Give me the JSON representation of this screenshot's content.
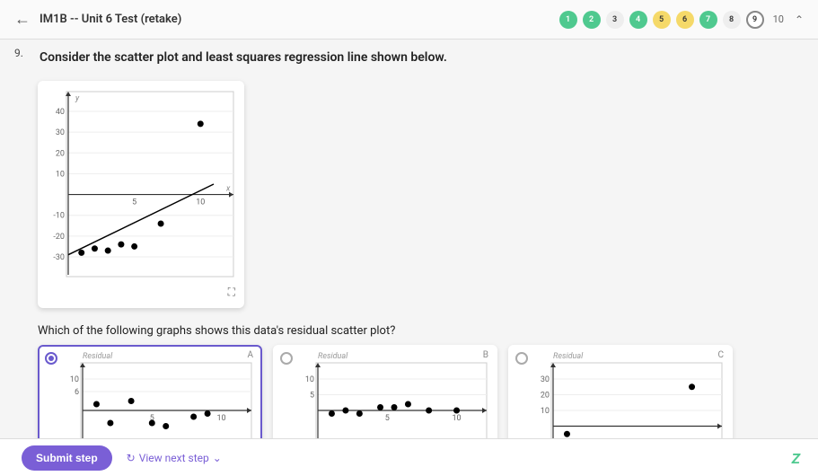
{
  "header": {
    "title": "IM1B -- Unit 6 Test (retake)",
    "nav": [
      {
        "label": "1",
        "cls": "green"
      },
      {
        "label": "2",
        "cls": "green"
      },
      {
        "label": "3",
        "cls": "plain"
      },
      {
        "label": "4",
        "cls": "green"
      },
      {
        "label": "5",
        "cls": "yellow"
      },
      {
        "label": "6",
        "cls": "yellow"
      },
      {
        "label": "7",
        "cls": "green"
      },
      {
        "label": "8",
        "cls": "plain"
      },
      {
        "label": "9",
        "cls": "current"
      }
    ],
    "total": "10"
  },
  "question": {
    "number": "9.",
    "prompt": "Consider the scatter plot and least squares regression line shown below.",
    "subprompt": "Which of the following graphs shows this data's residual scatter plot?"
  },
  "chart_data": {
    "type": "scatter",
    "title": "",
    "xlabel": "x",
    "ylabel": "y",
    "xlim": [
      0,
      11
    ],
    "ylim": [
      -30,
      40
    ],
    "xticks": [
      5,
      10
    ],
    "yticks": [
      -30,
      -20,
      -10,
      10,
      20,
      30,
      40
    ],
    "points": [
      {
        "x": 1,
        "y": -28
      },
      {
        "x": 2,
        "y": -26
      },
      {
        "x": 3,
        "y": -27
      },
      {
        "x": 4,
        "y": -24
      },
      {
        "x": 5,
        "y": -25
      },
      {
        "x": 7,
        "y": -14
      },
      {
        "x": 10,
        "y": 34
      }
    ],
    "regression_line": {
      "x1": 0,
      "y1": -29,
      "x2": 11,
      "y2": 5
    }
  },
  "options": [
    {
      "letter": "A",
      "label": "Residual",
      "selected": true,
      "chart": {
        "type": "scatter",
        "ylim": [
          -10,
          10
        ],
        "xlim": [
          0,
          11
        ],
        "yticks": [
          6,
          10
        ],
        "xticks": [
          5,
          10
        ],
        "points": [
          {
            "x": 1,
            "y": 2
          },
          {
            "x": 2,
            "y": -4
          },
          {
            "x": 3.5,
            "y": 3
          },
          {
            "x": 5,
            "y": -4
          },
          {
            "x": 6,
            "y": -5
          },
          {
            "x": 8,
            "y": -2
          },
          {
            "x": 9,
            "y": -1
          }
        ]
      }
    },
    {
      "letter": "B",
      "label": "Residual",
      "selected": false,
      "chart": {
        "type": "scatter",
        "ylim": [
          -10,
          10
        ],
        "xlim": [
          0,
          11
        ],
        "yticks": [
          5,
          10
        ],
        "xticks": [
          5,
          10
        ],
        "points": [
          {
            "x": 1,
            "y": -1
          },
          {
            "x": 2,
            "y": 0
          },
          {
            "x": 3,
            "y": -1
          },
          {
            "x": 4.5,
            "y": 1
          },
          {
            "x": 5.5,
            "y": 1
          },
          {
            "x": 6.5,
            "y": 2
          },
          {
            "x": 8,
            "y": 0
          },
          {
            "x": 10,
            "y": 0
          }
        ]
      }
    },
    {
      "letter": "C",
      "label": "Residual",
      "selected": false,
      "chart": {
        "type": "scatter",
        "ylim": [
          -10,
          30
        ],
        "xlim": [
          0,
          11
        ],
        "yticks": [
          10,
          20,
          30
        ],
        "xticks": [],
        "points": [
          {
            "x": 1,
            "y": -5
          },
          {
            "x": 10,
            "y": 25
          }
        ]
      }
    }
  ],
  "footer": {
    "submit": "Submit step",
    "next": "View next step"
  }
}
